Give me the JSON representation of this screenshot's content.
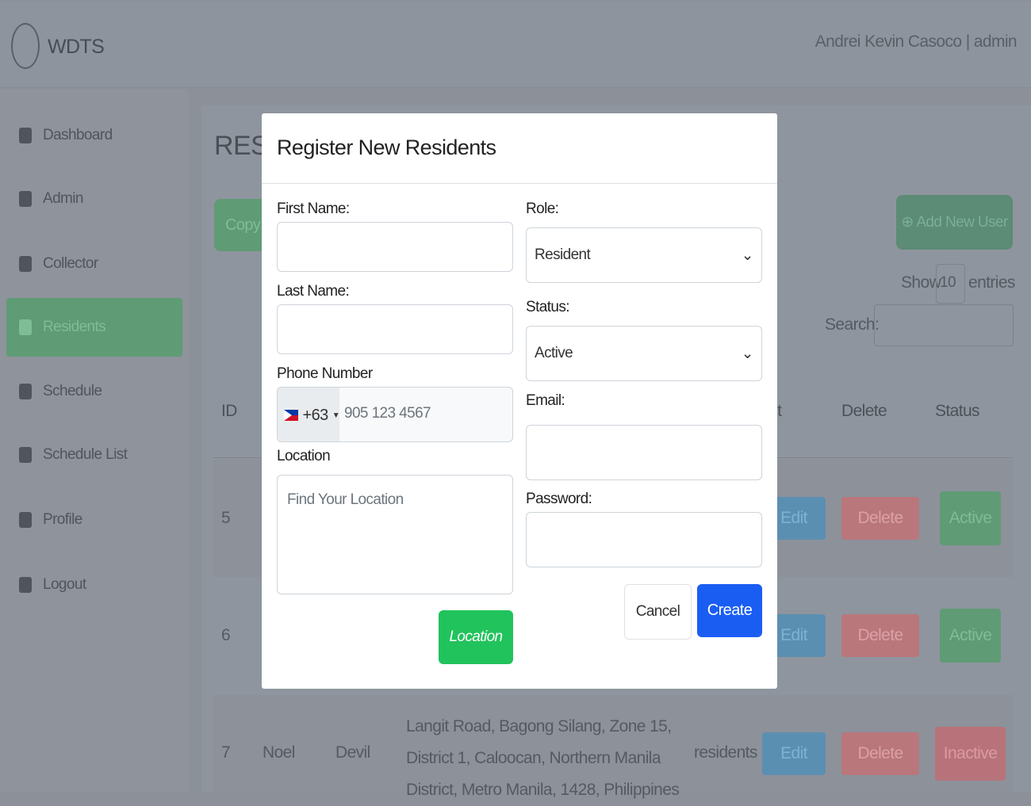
{
  "header": {
    "brand": "WDTS",
    "user": "Andrei Kevin Casoco | admin"
  },
  "sidebar": {
    "items": [
      {
        "label": "Dashboard",
        "icon": "dashboard-icon"
      },
      {
        "label": "Admin",
        "icon": "user-icon"
      },
      {
        "label": "Collector",
        "icon": "map-pin-icon"
      },
      {
        "label": "Residents",
        "icon": "user-icon",
        "active": true
      },
      {
        "label": "Schedule",
        "icon": "calendar-icon"
      },
      {
        "label": "Schedule List",
        "icon": "calendar-icon"
      },
      {
        "label": "Profile",
        "icon": "profile-icon"
      },
      {
        "label": "Logout",
        "icon": "logout-icon"
      }
    ]
  },
  "page": {
    "title": "RESI",
    "copy": "Copy",
    "add_new_user": "⊕ Add New User",
    "show": "Show",
    "show_value": "10",
    "entries": "entries",
    "search": "Search:"
  },
  "table": {
    "headers": [
      "ID",
      "it",
      "Delete",
      "Status"
    ],
    "rows": [
      {
        "id": "5",
        "edit": "Edit",
        "delete": "Delete",
        "status": "Active"
      },
      {
        "id": "6",
        "edit": "Edit",
        "delete": "Delete",
        "status": "Active"
      },
      {
        "id": "7",
        "first": "Noel",
        "last": "Devil",
        "location": "Langit Road, Bagong Silang, Zone 15, District 1, Caloocan, Northern Manila District, Metro Manila, 1428, Philippines",
        "role": "residents",
        "edit": "Edit",
        "delete": "Delete",
        "status": "Inactive"
      }
    ]
  },
  "modal": {
    "title": "Register New Residents",
    "first_name": "First Name:",
    "last_name": "Last Name:",
    "phone": "Phone Number",
    "country_code": "+63",
    "phone_placeholder": "905 123 4567",
    "location": "Location",
    "location_placeholder": "Find Your Location",
    "location_button": "Location",
    "role": "Role:",
    "role_value": "Resident",
    "status": "Status:",
    "status_value": "Active",
    "email": "Email:",
    "password": "Password:",
    "cancel": "Cancel",
    "create": "Create"
  },
  "colors": {
    "create": "#1a5df3",
    "location": "#21c35c",
    "active": "#5f9b75",
    "delete": "#b9777b",
    "edit": "#5b8fb1"
  }
}
